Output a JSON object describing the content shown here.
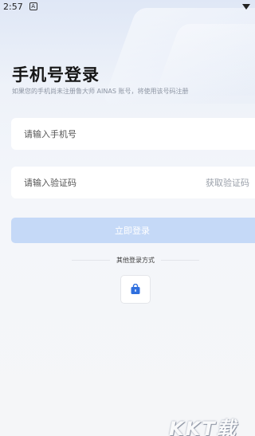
{
  "status_bar": {
    "time": "2:57",
    "notification_icon": "A"
  },
  "title": "手机号登录",
  "subtitle": "如果您的手机尚未注册鲁大师 AINAS 账号，将使用该号码注册",
  "phone": {
    "placeholder": "请输入手机号",
    "value": ""
  },
  "code": {
    "placeholder": "请输入验证码",
    "value": "",
    "get_code_label": "获取验证码"
  },
  "login_button_label": "立即登录",
  "other_login_label": "其他登录方式",
  "alt_login_icon": "bag-icon",
  "watermark": "KKT载",
  "colors": {
    "accent_disabled": "#c5d9f7",
    "alt_icon": "#2f6fde"
  }
}
